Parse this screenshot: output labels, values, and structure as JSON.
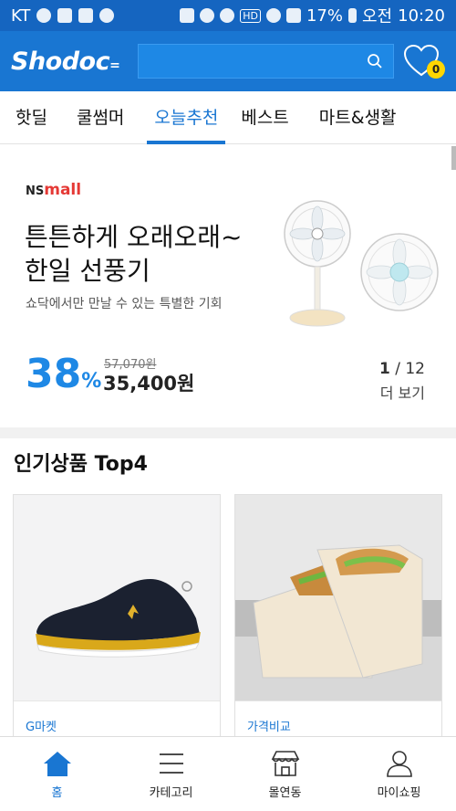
{
  "status_bar": {
    "carrier": "KT",
    "battery": "17%",
    "ampm": "오전",
    "time": "10:20",
    "hd": "HD"
  },
  "header": {
    "logo": "Shodoc",
    "search_placeholder": "",
    "wishlist_count": "0"
  },
  "tabs": [
    {
      "label": "핫딜",
      "active": false
    },
    {
      "label": "쿨썸머",
      "active": false
    },
    {
      "label": "오늘추천",
      "active": true
    },
    {
      "label": "베스트",
      "active": false
    },
    {
      "label": "마트&생활",
      "active": false
    }
  ],
  "promo": {
    "brand_ns": "NS",
    "brand_mall": "mall",
    "title": "튼튼하게 오래오래~\n한일 선풍기",
    "subtitle": "쇼닥에서만 만날 수 있는 특별한 기회",
    "discount_value": "38",
    "discount_unit": "%",
    "original_price": "57,070원",
    "sale_price": "35,400원",
    "page_current": "1",
    "page_total": "/ 12",
    "more_label": "더 보기"
  },
  "top4": {
    "title": "인기상품 Top4",
    "items": [
      {
        "store": "G마켓",
        "image": "basketball-sneaker"
      },
      {
        "store": "가격비교",
        "image": "toaster-sandwich-bags"
      }
    ]
  },
  "bottom_nav": [
    {
      "label": "홈",
      "icon": "home-icon",
      "active": true
    },
    {
      "label": "카테고리",
      "icon": "menu-icon",
      "active": false
    },
    {
      "label": "몰연동",
      "icon": "store-icon",
      "active": false
    },
    {
      "label": "마이쇼핑",
      "icon": "person-icon",
      "active": false
    }
  ],
  "colors": {
    "primary": "#1976d2",
    "status_bar": "#1565c0",
    "accent_discount": "#1e88e5",
    "badge": "#ffd600",
    "brand_red": "#e53935"
  }
}
